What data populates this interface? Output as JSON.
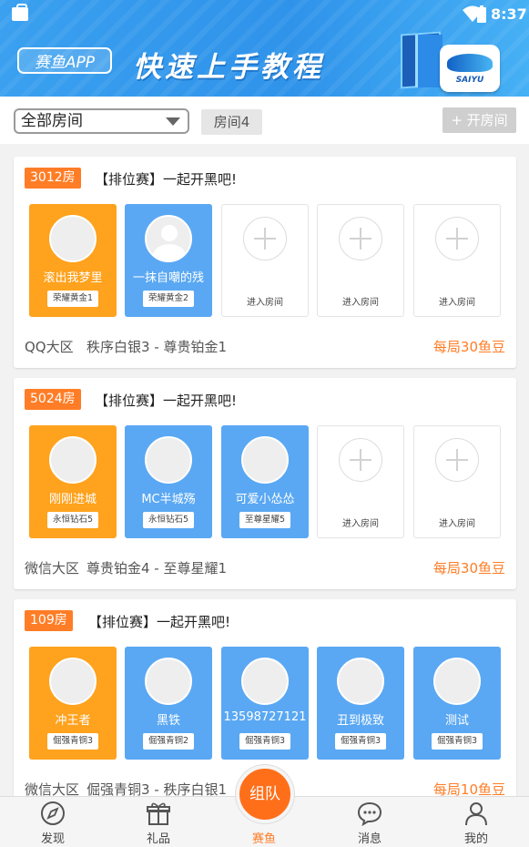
{
  "status_bar": {
    "time": "8:37"
  },
  "banner": {
    "app_badge": "赛鱼APP",
    "title": "快速上手教程",
    "logo_text": "SAIYU"
  },
  "filter": {
    "selected": "全部房间",
    "room_count": "房间4",
    "open_room_label": "+ 开房间"
  },
  "rooms": [
    {
      "room_no": "3012房",
      "title": "【排位赛】一起开黑吧!",
      "zone": "QQ大区",
      "rank_range": "秩序白银3 - 尊贵铂金1",
      "fee": "每局30鱼豆",
      "slots": [
        {
          "state": "filled",
          "color": "orange",
          "avatar": "shield",
          "name": "滚出我梦里",
          "rank": "荣耀黄金1"
        },
        {
          "state": "filled",
          "color": "blue",
          "avatar": "person",
          "name": "一抹自嘲的残",
          "rank": "荣耀黄金2"
        },
        {
          "state": "empty",
          "label": "进入房间"
        },
        {
          "state": "empty",
          "label": "进入房间"
        },
        {
          "state": "empty",
          "label": "进入房间"
        }
      ]
    },
    {
      "room_no": "5024房",
      "title": "【排位赛】一起开黑吧!",
      "zone": "微信大区",
      "rank_range": "尊贵铂金4 - 至尊星耀1",
      "fee": "每局30鱼豆",
      "slots": [
        {
          "state": "filled",
          "color": "orange",
          "avatar": "sponge",
          "name": "刚刚进城",
          "rank": "永恒钻石5"
        },
        {
          "state": "filled",
          "color": "blue",
          "avatar": "dark",
          "name": "MC半城殇",
          "rank": "永恒钻石5"
        },
        {
          "state": "filled",
          "color": "blue",
          "avatar": "cat",
          "name": "可爱小怂怂",
          "rank": "至尊星耀5"
        },
        {
          "state": "empty",
          "label": "进入房间"
        },
        {
          "state": "empty",
          "label": "进入房间"
        }
      ]
    },
    {
      "room_no": "109房",
      "title": "【排位赛】一起开黑吧!",
      "zone": "微信大区",
      "rank_range": "倔强青铜3 - 秩序白银1",
      "fee": "每局10鱼豆",
      "slots": [
        {
          "state": "filled",
          "color": "orange",
          "avatar": "lion",
          "name": "冲王者",
          "rank": "倔强青铜3"
        },
        {
          "state": "filled",
          "color": "blue",
          "avatar": "girl",
          "name": "黑铁",
          "rank": "倔强青铜2"
        },
        {
          "state": "filled",
          "color": "blue",
          "avatar": "phone",
          "name": "13598727121",
          "rank": "倔强青铜3"
        },
        {
          "state": "filled",
          "color": "blue",
          "avatar": "hero",
          "name": "丑到极致",
          "rank": "倔强青铜3"
        },
        {
          "state": "filled",
          "color": "blue",
          "avatar": "red",
          "name": "测试",
          "rank": "倔强青铜3"
        }
      ]
    }
  ],
  "nav": {
    "items": [
      {
        "label": "发现",
        "icon": "compass-icon"
      },
      {
        "label": "礼品",
        "icon": "gift-icon"
      },
      {
        "label": "赛鱼",
        "icon": "team-icon",
        "active": true
      },
      {
        "label": "消息",
        "icon": "chat-icon"
      },
      {
        "label": "我的",
        "icon": "user-icon"
      }
    ],
    "center_button": "组队"
  },
  "colors": {
    "accent": "#ff7d26",
    "slot_orange": "#ffa21d",
    "slot_blue": "#5aa8f3",
    "banner": "#3aa0ef"
  }
}
